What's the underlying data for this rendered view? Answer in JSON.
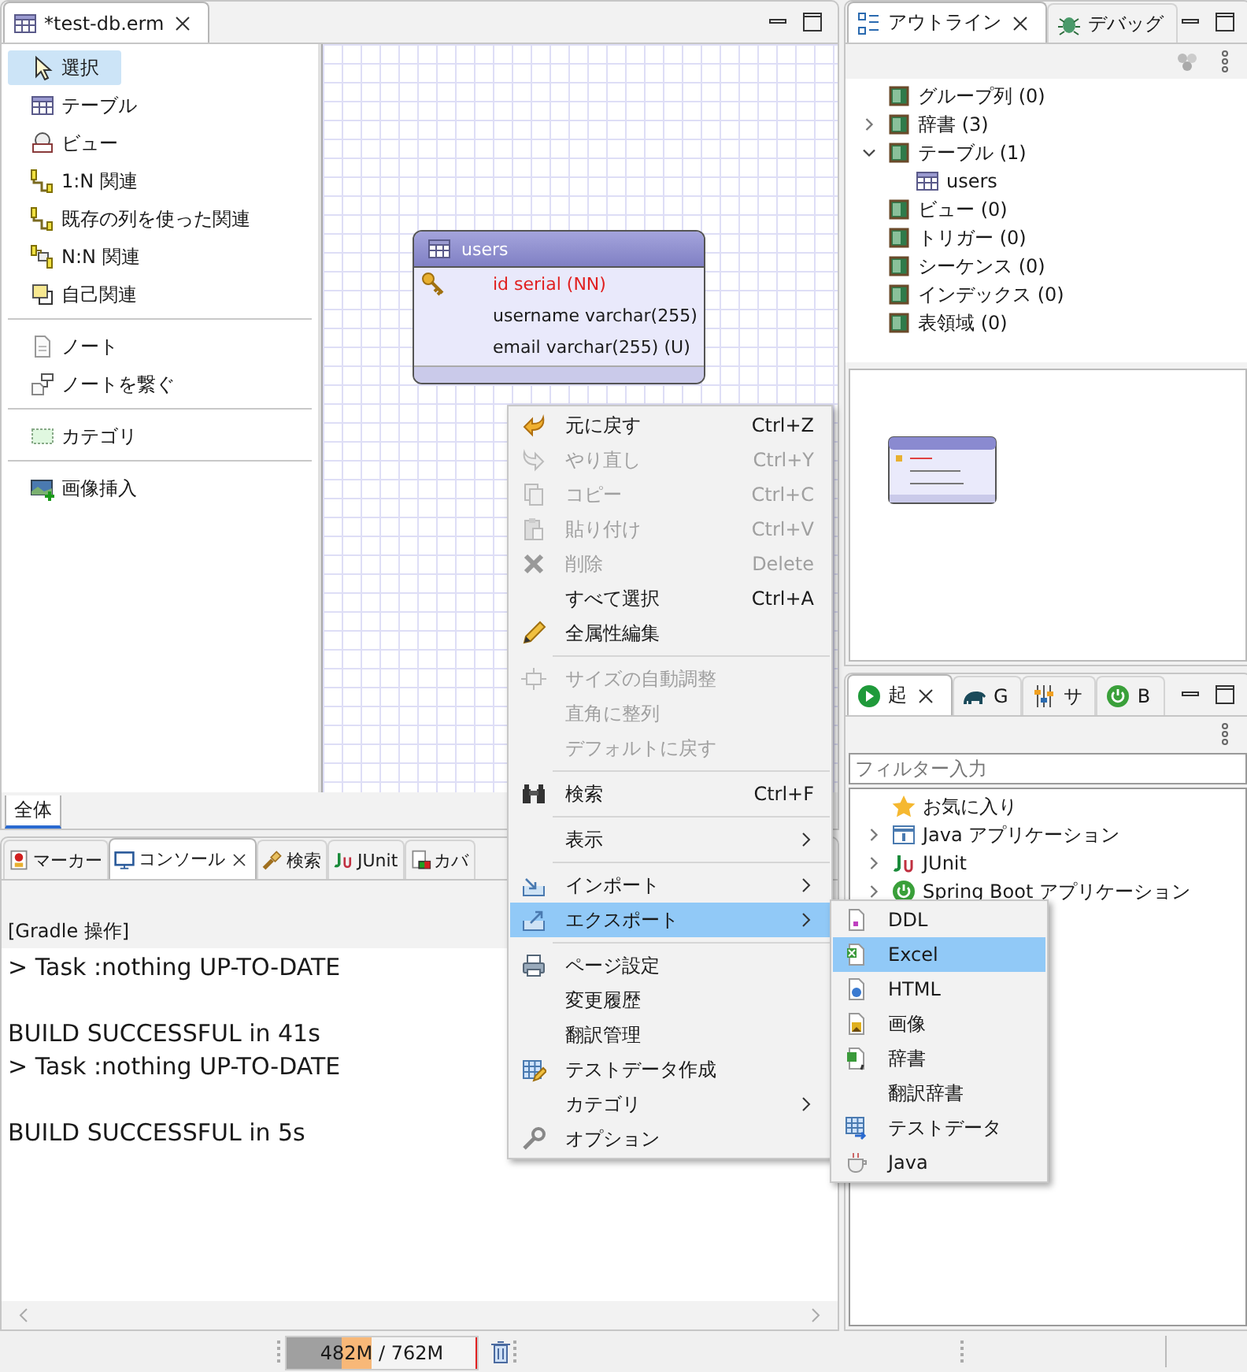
{
  "editor": {
    "tabs": [
      {
        "label": "*test-db.erm",
        "selected": true
      }
    ],
    "palette": {
      "groups": [
        {
          "items": [
            {
              "label": "選択",
              "selected": true
            },
            {
              "label": "テーブル",
              "selected": false
            },
            {
              "label": "ビュー",
              "selected": false
            },
            {
              "label": "1:N 関連",
              "selected": false
            },
            {
              "label": "既存の列を使った関連",
              "selected": false
            },
            {
              "label": "N:N 関連",
              "selected": false
            },
            {
              "label": "自己関連",
              "selected": false
            }
          ]
        },
        {
          "items": [
            {
              "label": "ノート",
              "selected": false
            },
            {
              "label": "ノートを繋ぐ",
              "selected": false
            }
          ]
        },
        {
          "items": [
            {
              "label": "カテゴリ",
              "selected": false
            }
          ]
        },
        {
          "items": [
            {
              "label": "画像挿入",
              "selected": false
            }
          ]
        }
      ]
    },
    "palette_tab": "全体",
    "diagram": {
      "tables": [
        {
          "name": "users",
          "columns": [
            {
              "text": "id serial (NN)",
              "primary_key": true
            },
            {
              "text": "username varchar(255)",
              "primary_key": false
            },
            {
              "text": "email varchar(255) (U)",
              "primary_key": false
            }
          ]
        }
      ]
    }
  },
  "console": {
    "tabs": [
      {
        "label": "マーカー",
        "selected": false
      },
      {
        "label": "コンソール",
        "selected": true
      },
      {
        "label": "検索",
        "selected": false
      },
      {
        "label": "JUnit",
        "selected": false
      },
      {
        "label": "カバ",
        "selected": false
      }
    ],
    "header": "[Gradle 操作]",
    "blocks": [
      [
        "> Task :nothing UP-TO-DATE"
      ],
      [
        "BUILD SUCCESSFUL in 41s",
        "> Task :nothing UP-TO-DATE"
      ],
      [
        "BUILD SUCCESSFUL in 5s"
      ]
    ]
  },
  "outline": {
    "tabs": [
      {
        "label": "アウトライン",
        "selected": true
      },
      {
        "label": "デバッグ",
        "selected": false
      }
    ],
    "tree": [
      {
        "label": "グループ列 (0)"
      },
      {
        "label": "辞書 (3)",
        "expanded": false
      },
      {
        "label": "テーブル (1)",
        "expanded": true,
        "children": [
          {
            "label": "users"
          }
        ]
      },
      {
        "label": "ビュー (0)"
      },
      {
        "label": "トリガー (0)"
      },
      {
        "label": "シーケンス (0)"
      },
      {
        "label": "インデックス (0)"
      },
      {
        "label": "表領域 (0)"
      }
    ]
  },
  "launch": {
    "tabs": [
      {
        "label": "起",
        "selected": true
      },
      {
        "label": "G",
        "selected": false
      },
      {
        "label": "サ",
        "selected": false
      },
      {
        "label": "B",
        "selected": false
      }
    ],
    "filter": {
      "placeholder": "フィルター入力"
    },
    "tree": [
      {
        "label": "お気に入り"
      },
      {
        "label": "Java アプリケーション",
        "expanded": false
      },
      {
        "label": "JUnit",
        "expanded": false
      },
      {
        "label": "Spring Boot アプリケーション",
        "expanded": false
      }
    ]
  },
  "context_menu": {
    "items": [
      {
        "kind": "item",
        "label": "元に戻す",
        "shortcut": "Ctrl+Z",
        "disabled": false,
        "submenu": false,
        "selected": false
      },
      {
        "kind": "item",
        "label": "やり直し",
        "shortcut": "Ctrl+Y",
        "disabled": true,
        "submenu": false,
        "selected": false
      },
      {
        "kind": "item",
        "label": "コピー",
        "shortcut": "Ctrl+C",
        "disabled": true,
        "submenu": false,
        "selected": false
      },
      {
        "kind": "item",
        "label": "貼り付け",
        "shortcut": "Ctrl+V",
        "disabled": true,
        "submenu": false,
        "selected": false
      },
      {
        "kind": "item",
        "label": "削除",
        "shortcut": "Delete",
        "disabled": true,
        "submenu": false,
        "selected": false
      },
      {
        "kind": "item",
        "label": "すべて選択",
        "shortcut": "Ctrl+A",
        "disabled": false,
        "submenu": false,
        "selected": false
      },
      {
        "kind": "item",
        "label": "全属性編集",
        "disabled": false,
        "submenu": false,
        "selected": false
      },
      {
        "kind": "separator"
      },
      {
        "kind": "item",
        "label": "サイズの自動調整",
        "disabled": true,
        "submenu": false,
        "selected": false
      },
      {
        "kind": "item",
        "label": "直角に整列",
        "disabled": true,
        "submenu": false,
        "selected": false
      },
      {
        "kind": "item",
        "label": "デフォルトに戻す",
        "disabled": true,
        "submenu": false,
        "selected": false
      },
      {
        "kind": "separator"
      },
      {
        "kind": "item",
        "label": "検索",
        "shortcut": "Ctrl+F",
        "disabled": false,
        "submenu": false,
        "selected": false
      },
      {
        "kind": "separator"
      },
      {
        "kind": "item",
        "label": "表示",
        "disabled": false,
        "submenu": true,
        "selected": false
      },
      {
        "kind": "separator"
      },
      {
        "kind": "item",
        "label": "インポート",
        "disabled": false,
        "submenu": true,
        "selected": false
      },
      {
        "kind": "item",
        "label": "エクスポート",
        "disabled": false,
        "submenu": true,
        "selected": true
      },
      {
        "kind": "separator"
      },
      {
        "kind": "item",
        "label": "ページ設定",
        "disabled": false,
        "submenu": false,
        "selected": false
      },
      {
        "kind": "item",
        "label": "変更履歴",
        "disabled": false,
        "submenu": false,
        "selected": false
      },
      {
        "kind": "item",
        "label": "翻訳管理",
        "disabled": false,
        "submenu": false,
        "selected": false
      },
      {
        "kind": "item",
        "label": "テストデータ作成",
        "disabled": false,
        "submenu": false,
        "selected": false
      },
      {
        "kind": "item",
        "label": "カテゴリ",
        "disabled": false,
        "submenu": true,
        "selected": false
      },
      {
        "kind": "item",
        "label": "オプション",
        "disabled": false,
        "submenu": false,
        "selected": false
      }
    ]
  },
  "export_submenu": {
    "items": [
      {
        "label": "DDL",
        "selected": false
      },
      {
        "label": "Excel",
        "selected": true
      },
      {
        "label": "HTML",
        "selected": false
      },
      {
        "label": "画像",
        "selected": false
      },
      {
        "label": "辞書",
        "selected": false
      },
      {
        "label": "翻訳辞書",
        "selected": false
      },
      {
        "label": "テストデータ",
        "selected": false
      },
      {
        "label": "Java",
        "selected": false
      }
    ]
  },
  "status_bar": {
    "heap": {
      "text": "482M / 762M",
      "level": 0.45
    }
  }
}
